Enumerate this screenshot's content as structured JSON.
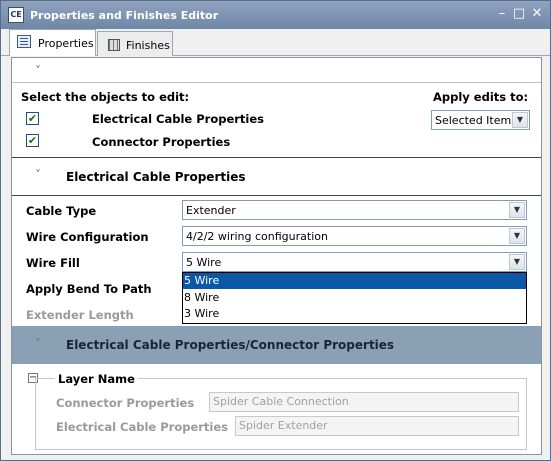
{
  "window": {
    "icon_text": "CE",
    "title": "Properties and Finishes Editor",
    "minimize": "–",
    "maximize": "□",
    "close": "✕"
  },
  "tabs": [
    {
      "label": "Properties",
      "active": true,
      "icon": "properties-icon"
    },
    {
      "label": "Finishes",
      "active": false,
      "icon": "finishes-icon"
    }
  ],
  "selection": {
    "heading": "Select the objects to edit:",
    "apply_heading": "Apply edits to:",
    "apply_value": "Selected Items",
    "items": [
      {
        "label": "Electrical Cable Properties",
        "checked": true
      },
      {
        "label": "Connector Properties",
        "checked": true
      }
    ]
  },
  "cable_section": {
    "title": "Electrical Cable Properties",
    "rows": [
      {
        "label": "Cable Type",
        "value": "Extender"
      },
      {
        "label": "Wire Configuration",
        "value": "4/2/2 wiring configuration"
      },
      {
        "label": "Wire Fill",
        "value": "5 Wire"
      },
      {
        "label": "Apply Bend To Path",
        "value": ""
      },
      {
        "label": "Extender Length",
        "value": ""
      }
    ],
    "dropdown_options": [
      "5 Wire",
      "8 Wire",
      "3 Wire"
    ],
    "dropdown_selected": "5 Wire"
  },
  "combined_section": {
    "title": "Electrical Cable Properties/Connector Properties",
    "layer_label": "Layer Name",
    "rows": [
      {
        "label": "Connector Properties",
        "value": "Spider Cable Connection"
      },
      {
        "label": "Electrical Cable Properties",
        "value": "Spider Extender"
      }
    ]
  },
  "icons": {
    "collapse_chevron": "˅",
    "dropdown_arrow": "▼",
    "check": "✔",
    "tree_collapse": "−"
  },
  "colors": {
    "titlebar": "#7b90ae",
    "selection_highlight": "#0a58a6",
    "group_band": "#8aa1b5"
  }
}
